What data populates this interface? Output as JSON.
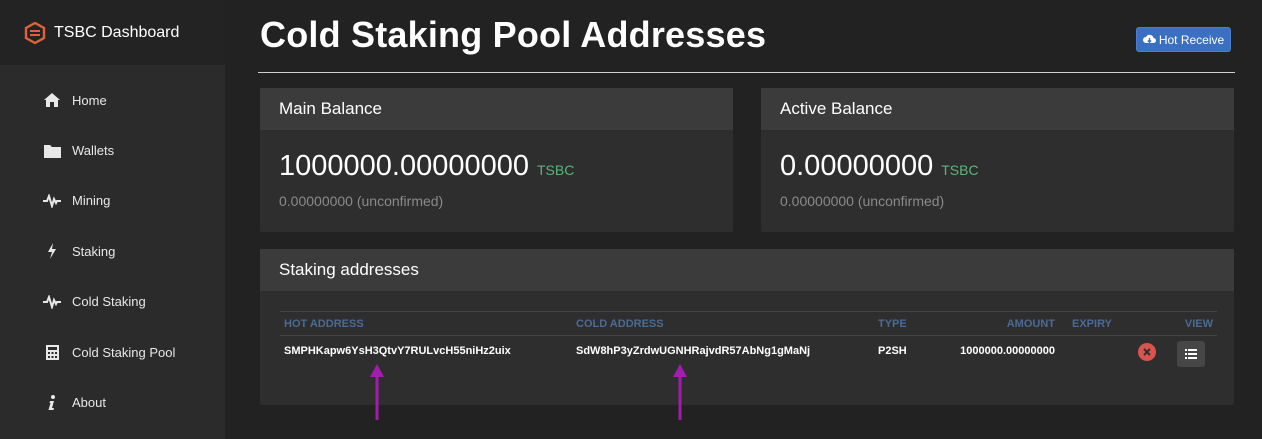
{
  "sidebar": {
    "brand": "TSBC Dashboard",
    "items": [
      {
        "label": "Home",
        "icon": "home-icon"
      },
      {
        "label": "Wallets",
        "icon": "folder-icon"
      },
      {
        "label": "Mining",
        "icon": "pulse-icon"
      },
      {
        "label": "Staking",
        "icon": "bolt-icon"
      },
      {
        "label": "Cold Staking",
        "icon": "pulse-icon"
      },
      {
        "label": "Cold Staking Pool",
        "icon": "calculator-icon"
      },
      {
        "label": "About",
        "icon": "info-icon"
      }
    ]
  },
  "header": {
    "title": "Cold Staking Pool Addresses",
    "hot_receive_label": "Hot Receive",
    "hot_receive_icon": "cloud-download-icon"
  },
  "main_balance": {
    "title": "Main Balance",
    "amount": "1000000.00000000",
    "unit": "TSBC",
    "unconfirmed": "0.00000000 (unconfirmed)"
  },
  "active_balance": {
    "title": "Active Balance",
    "amount": "0.00000000",
    "unit": "TSBC",
    "unconfirmed": "0.00000000 (unconfirmed)"
  },
  "staking": {
    "title": "Staking addresses",
    "columns": {
      "hot": "HOT ADDRESS",
      "cold": "COLD ADDRESS",
      "type": "TYPE",
      "amount": "AMOUNT",
      "expiry": "EXPIRY",
      "view": "VIEW"
    },
    "rows": [
      {
        "hot": "SMPHKapw6YsH3QtvY7RULvcH55niHz2uix",
        "cold": "SdW8hP3yZrdwUGNHRajvdR57AbNg1gMaNj",
        "type": "P2SH",
        "amount": "1000000.00000000",
        "expiry": ""
      }
    ]
  },
  "colors": {
    "accent": "#3a6fc2",
    "unit_green": "#5ab67a",
    "danger": "#d9534f",
    "annotation_arrow": "#a21caf"
  }
}
